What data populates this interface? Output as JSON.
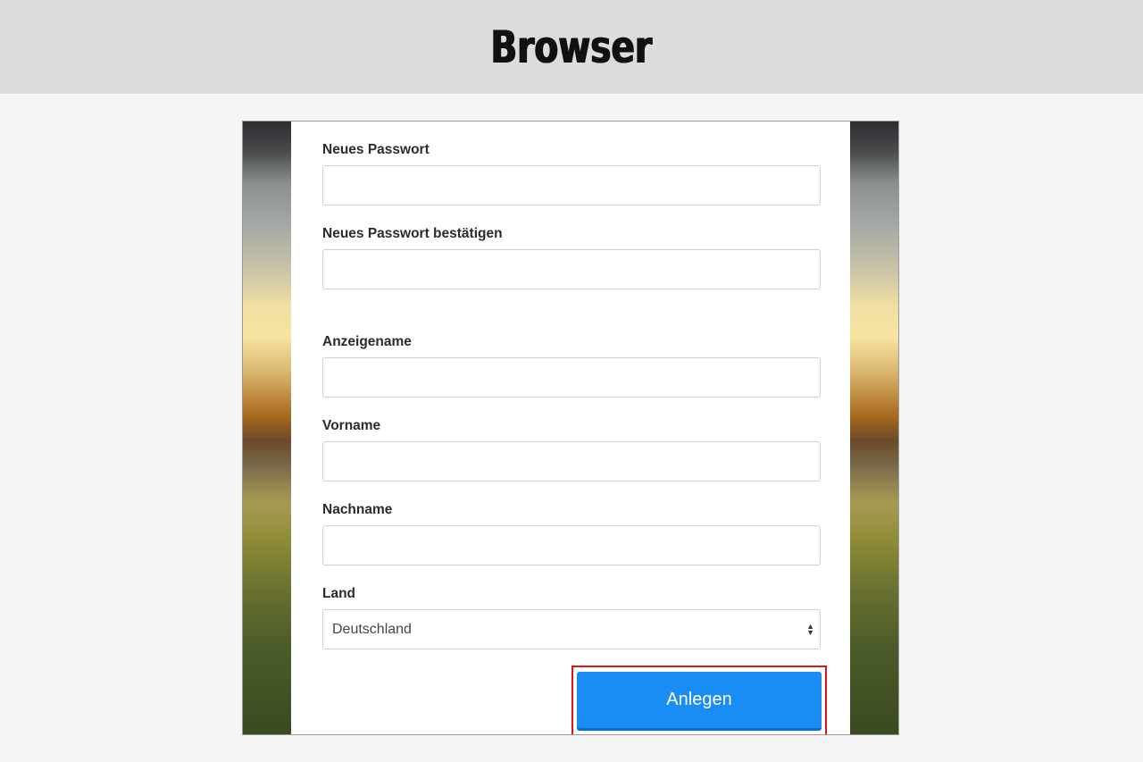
{
  "banner": {
    "title": "Browser"
  },
  "form": {
    "fields": [
      {
        "label": "Neues Passwort",
        "value": "",
        "type": "password"
      },
      {
        "label": "Neues Passwort bestätigen",
        "value": "",
        "type": "password"
      },
      {
        "label": "Anzeigename",
        "value": "",
        "type": "text"
      },
      {
        "label": "Vorname",
        "value": "",
        "type": "text"
      },
      {
        "label": "Nachname",
        "value": "",
        "type": "text"
      }
    ],
    "country": {
      "label": "Land",
      "selected": "Deutschland"
    },
    "submit_label": "Anlegen"
  },
  "colors": {
    "button_primary": "#1a8df5",
    "highlight": "#e0141c",
    "banner_bg": "#dcdcdc"
  },
  "icons": {
    "select_arrows": "chevron-up-down-icon"
  }
}
